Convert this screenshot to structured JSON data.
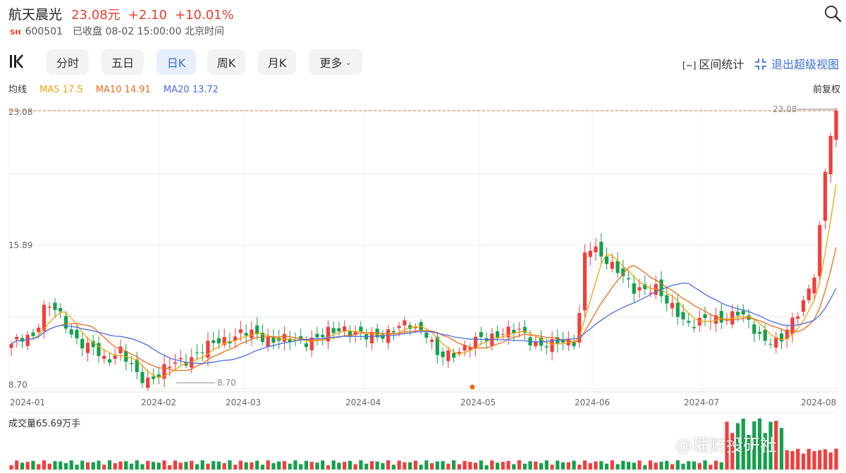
{
  "header": {
    "name": "航天晨光",
    "price": "23.08元",
    "change": "+2.10",
    "change_pct": "+10.01%",
    "market": "SH",
    "code": "600501",
    "status": "已收盘 08-02 15:00:00 北京时间"
  },
  "tabs": [
    {
      "label": "分时",
      "active": false
    },
    {
      "label": "五日",
      "active": false
    },
    {
      "label": "日K",
      "active": true
    },
    {
      "label": "周K",
      "active": false
    },
    {
      "label": "月K",
      "active": false
    },
    {
      "label": "更多",
      "active": false
    }
  ],
  "tools": {
    "interval_icon": "[~]",
    "interval_stats": "区间统计",
    "exit_view": "退出超级视图"
  },
  "ma": {
    "label": "均线",
    "ma5": "MA5 17.5",
    "ma10": "MA10 14.91",
    "ma20": "MA20 13.72",
    "adjust": "前复权"
  },
  "volume_label": "成交量65.69万手",
  "watermark": "@理财投研社",
  "colors": {
    "up": "#f23d3d",
    "down": "#14a04d",
    "ma5": "#f0a30a",
    "ma10": "#f06a1c",
    "ma20": "#4a6ce8"
  },
  "chart_data": {
    "type": "candlestick",
    "ylim": [
      8.7,
      23.08
    ],
    "y_ticks": [
      "23.08",
      "15.89",
      "8.70"
    ],
    "x_ticks": [
      "2024-01",
      "2024-02",
      "2024-03",
      "2024-04",
      "2024-05",
      "2024-06",
      "2024-07",
      "2024-08"
    ],
    "high_label": "23.08",
    "low_label": "8.70"
  }
}
